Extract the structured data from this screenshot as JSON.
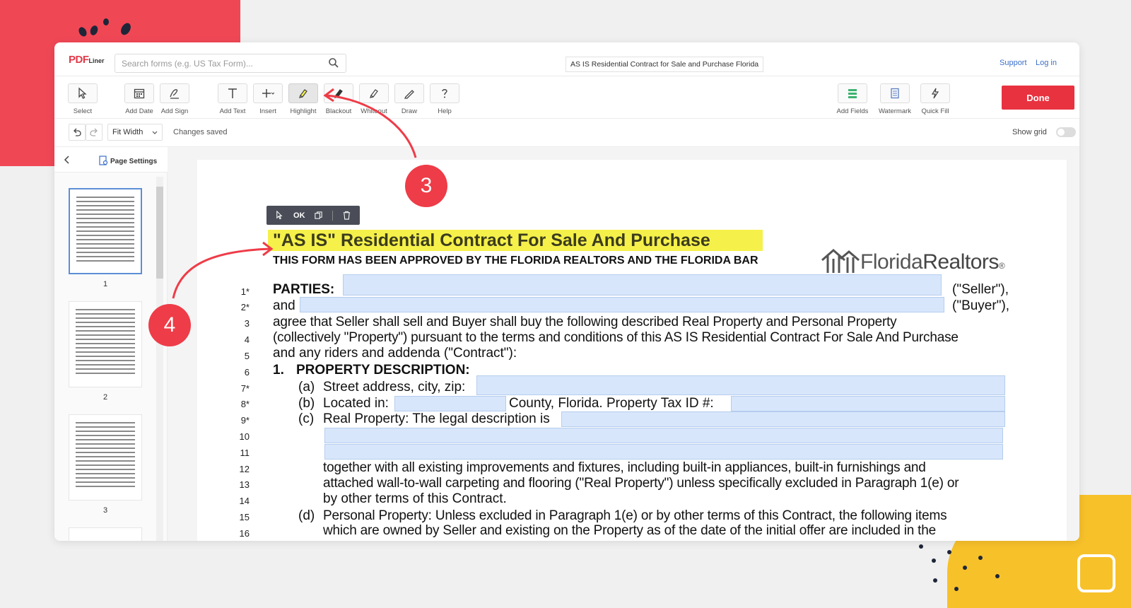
{
  "app": {
    "logo_text": "PDF",
    "logo_sub": "Liner",
    "search_placeholder": "Search forms (e.g. US Tax Form)...",
    "document_title": "AS IS Residential Contract for Sale and Purchase Florida",
    "links": {
      "support": "Support",
      "login": "Log in"
    }
  },
  "toolbar": {
    "tools": [
      {
        "label": "Select",
        "icon": "cursor-icon"
      },
      {
        "label": "Add Date",
        "icon": "calendar-icon"
      },
      {
        "label": "Add Sign",
        "icon": "signature-icon"
      },
      {
        "label": "Add Text",
        "icon": "text-icon"
      },
      {
        "label": "Insert",
        "icon": "plus-icon"
      },
      {
        "label": "Highlight",
        "icon": "highlighter-icon",
        "active": true
      },
      {
        "label": "Blackout",
        "icon": "marker-icon"
      },
      {
        "label": "Whiteout",
        "icon": "eraser-icon"
      },
      {
        "label": "Draw",
        "icon": "pen-icon"
      },
      {
        "label": "Help",
        "icon": "question-icon"
      }
    ],
    "right_tools": [
      {
        "label": "Add Fields",
        "icon": "fields-icon"
      },
      {
        "label": "Watermark",
        "icon": "watermark-icon"
      },
      {
        "label": "Quick Fill",
        "icon": "lightning-icon"
      }
    ],
    "done_label": "Done"
  },
  "subbar": {
    "zoom": "Fit Width",
    "status": "Changes saved",
    "show_grid_label": "Show grid",
    "show_grid": false
  },
  "sidebar": {
    "page_settings_label": "Page Settings",
    "thumbnails": [
      "1",
      "2",
      "3"
    ]
  },
  "edit_popup": {
    "ok_label": "OK"
  },
  "document": {
    "title": "\"AS IS\" Residential Contract For Sale And Purchase",
    "subtitle": "THIS FORM HAS BEEN APPROVED BY THE FLORIDA REALTORS AND THE FLORIDA BAR",
    "brand": {
      "part1": "Florida",
      "part2": "Realtors",
      "reg": "®"
    },
    "line_numbers": [
      "1*",
      "2*",
      "3",
      "4",
      "5",
      "6",
      "7*",
      "8*",
      "9*",
      "10",
      "11",
      "12",
      "13",
      "14",
      "15",
      "16"
    ],
    "text": {
      "parties": "PARTIES:",
      "seller": "(\"Seller\"),",
      "and": "and",
      "buyer": "(\"Buyer\"),",
      "l3": "agree  that  Seller  shall  sell  and  Buyer  shall  buy  the  following  described  Real  Property  and  Personal  Property",
      "l4": "(collectively \"Property\") pursuant to the terms and conditions of this AS IS Residential Contract For Sale And Purchase",
      "l5": "and any riders and addenda (\"Contract\"):",
      "l6_num": "1.",
      "l6": "PROPERTY DESCRIPTION:",
      "a_label": "(a)",
      "a_text": "Street address, city, zip:",
      "b_label": "(b)",
      "b_text": "Located in:",
      "b_mid": "County, Florida. Property Tax ID #:",
      "c_label": "(c)",
      "c_text": "Real Property: The legal description is",
      "l12": "together  with  all  existing  improvements  and  fixtures,  including  built-in  appliances,  built-in  furnishings  and",
      "l13": "attached wall-to-wall carpeting and flooring (\"Real Property\") unless specifically excluded in Paragraph 1(e) or",
      "l14": "by other terms of this Contract.",
      "d_label": "(d)",
      "d_text": "Personal Property: Unless excluded in Paragraph 1(e) or by other terms of this Contract, the following items",
      "l16": "which are owned by Seller and existing on the Property as of the date of the initial offer are included in the"
    }
  },
  "annotations": {
    "step3": "3",
    "step4": "4"
  },
  "colors": {
    "accent_red": "#e8323f",
    "highlight_yellow": "#f5f14a",
    "field_blue": "#d7e6fb",
    "deco_red": "#f04755",
    "deco_yellow": "#f7c12a"
  }
}
